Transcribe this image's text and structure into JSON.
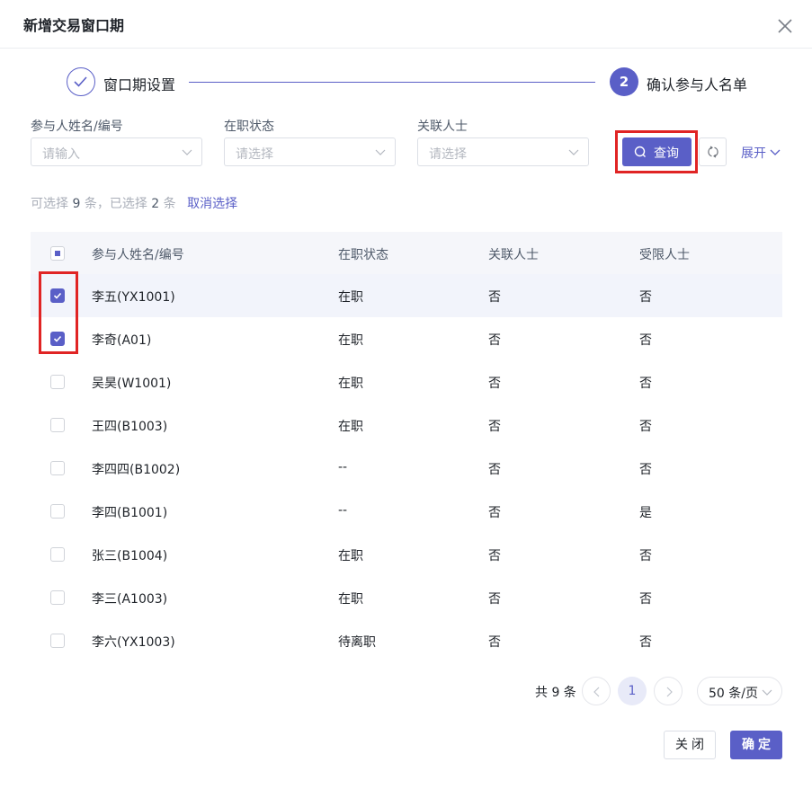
{
  "dialog": {
    "title": "新增交易窗口期"
  },
  "steps": [
    {
      "label": "窗口期设置",
      "status": "done"
    },
    {
      "number": "2",
      "label": "确认参与人名单",
      "status": "active"
    }
  ],
  "filters": [
    {
      "label": "参与人姓名/编号",
      "placeholder": "请输入"
    },
    {
      "label": "在职状态",
      "placeholder": "请选择"
    },
    {
      "label": "关联人士",
      "placeholder": "请选择"
    }
  ],
  "actions": {
    "query_label": "查询",
    "expand_label": "展开"
  },
  "selection": {
    "prefix": "可选择",
    "available": "9",
    "mid": "条，已选择",
    "selected": "2",
    "suffix": "条",
    "cancel_label": "取消选择"
  },
  "table": {
    "columns": [
      "参与人姓名/编号",
      "在职状态",
      "关联人士",
      "受限人士"
    ],
    "rows": [
      {
        "name": "李五(YX1001)",
        "status": "在职",
        "related": "否",
        "restricted": "否",
        "checked": true
      },
      {
        "name": "李奇(A01)",
        "status": "在职",
        "related": "否",
        "restricted": "否",
        "checked": true
      },
      {
        "name": "吴昊(W1001)",
        "status": "在职",
        "related": "否",
        "restricted": "否",
        "checked": false
      },
      {
        "name": "王四(B1003)",
        "status": "在职",
        "related": "否",
        "restricted": "否",
        "checked": false
      },
      {
        "name": "李四四(B1002)",
        "status": "--",
        "related": "否",
        "restricted": "否",
        "checked": false
      },
      {
        "name": "李四(B1001)",
        "status": "--",
        "related": "否",
        "restricted": "是",
        "checked": false
      },
      {
        "name": "张三(B1004)",
        "status": "在职",
        "related": "否",
        "restricted": "否",
        "checked": false
      },
      {
        "name": "李三(A1003)",
        "status": "在职",
        "related": "否",
        "restricted": "否",
        "checked": false
      },
      {
        "name": "李六(YX1003)",
        "status": "待离职",
        "related": "否",
        "restricted": "否",
        "checked": false
      }
    ]
  },
  "pagination": {
    "total": "共 9 条",
    "current_page": "1",
    "page_size": "50 条/页"
  },
  "footer": {
    "close_label": "关闭",
    "ok_label": "确定"
  },
  "colors": {
    "accent": "#5a5fc7",
    "highlight": "#e02424"
  }
}
